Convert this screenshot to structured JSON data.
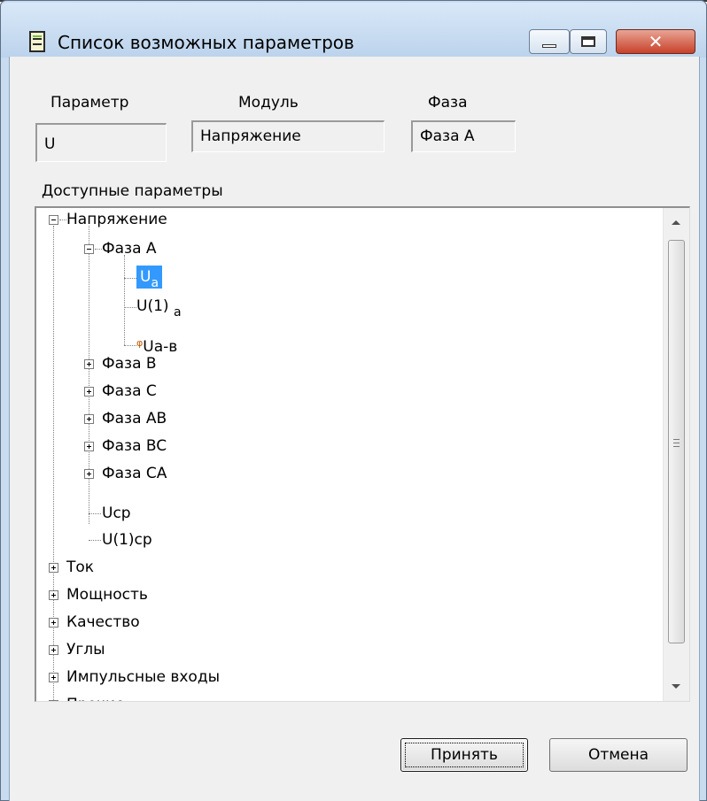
{
  "window": {
    "title": "Список возможных параметров"
  },
  "labels": {
    "param": "Параметр",
    "module": "Модуль",
    "phase": "Фаза",
    "available": "Доступные параметры"
  },
  "fields": {
    "param": "U",
    "module": "Напряжение",
    "phase": "Фаза А"
  },
  "tree": {
    "voltage": "Напряжение",
    "phaseA": "Фаза А",
    "ua_base": "U",
    "ua_sub": "a",
    "u1a_base": "U(1)",
    "u1a_sub": "a",
    "phi_glyph": "φ",
    "uab": "Ua-в",
    "phaseB": "Фаза B",
    "phaseC": "Фаза C",
    "phaseAB": "Фаза AB",
    "phaseBC": "Фаза BC",
    "phaseCA": "Фаза CA",
    "ucp": "Ucp",
    "u1cp": "U(1)cp",
    "current": "Ток",
    "power": "Мощность",
    "quality": "Качество",
    "angles": "Углы",
    "pulse": "Импульсные входы",
    "other": "Прочие"
  },
  "buttons": {
    "accept": "Принять",
    "cancel": "Отмена"
  },
  "colors": {
    "selection": "#3399ff",
    "close_button": "#c7412a"
  }
}
